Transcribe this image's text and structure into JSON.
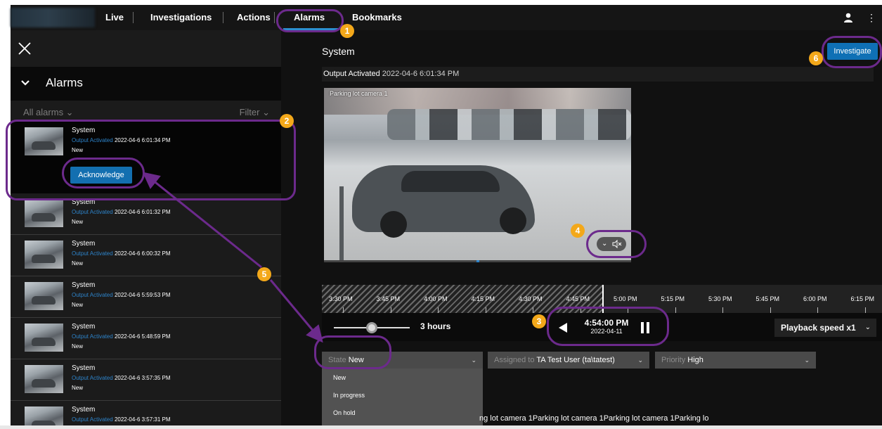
{
  "nav": {
    "items": [
      "Live",
      "Investigations",
      "Actions",
      "Alarms",
      "Bookmarks"
    ],
    "active": "Alarms",
    "user_icon": "user-icon",
    "menu_icon": "kebab-menu-icon"
  },
  "left_panel": {
    "close_icon": "close-icon",
    "header_title": "Alarms",
    "filter_all": "All alarms ⌄",
    "filter_label": "Filter ⌄",
    "alarms": [
      {
        "title": "System",
        "source": "Output Activated",
        "time": "2022-04-6 6:01:34 PM",
        "state": "New",
        "selected": true,
        "action": "Acknowledge"
      },
      {
        "title": "System",
        "source": "Output Activated",
        "time": "2022-04-6 6:01:32 PM",
        "state": "New"
      },
      {
        "title": "System",
        "source": "Output Activated",
        "time": "2022-04-6 6:00:32 PM",
        "state": "New"
      },
      {
        "title": "System",
        "source": "Output Activated",
        "time": "2022-04-6 5:59:53 PM",
        "state": "New"
      },
      {
        "title": "System",
        "source": "Output Activated",
        "time": "2022-04-6 5:48:59 PM",
        "state": "New"
      },
      {
        "title": "System",
        "source": "Output Activated",
        "time": "2022-04-6 3:57:35 PM",
        "state": "New"
      },
      {
        "title": "System",
        "source": "Output Activated",
        "time": "2022-04-6 3:57:31 PM",
        "state": ""
      }
    ]
  },
  "detail": {
    "title": "System",
    "investigate_label": "Investigate",
    "info_event": "Output Activated",
    "info_time": "2022-04-6 6:01:34 PM",
    "camera_name": "Parking lot camera 1",
    "timeline_ticks": [
      "3:30 PM",
      "3:45 PM",
      "4:00 PM",
      "4:15 PM",
      "4:30 PM",
      "4:45 PM",
      "5:00 PM",
      "5:15 PM",
      "5:30 PM",
      "5:45 PM",
      "6:00 PM",
      "6:15 PM"
    ],
    "span_label": "3 hours",
    "current_time": "4:54:00 PM",
    "current_date": "2022-04-11",
    "speed_label": "Playback speed x1",
    "state_label": "State",
    "state_value": "New",
    "assigned_label": "Assigned to",
    "assigned_value": "TA Test User (ta\\tatest)",
    "priority_label": "Priority",
    "priority_value": "High",
    "state_options": [
      "New",
      "In progress",
      "On hold"
    ],
    "description": "ng lot camera 1Parking lot camera 1Parking lot camera 1Parking lo"
  },
  "annotations": [
    "1",
    "2",
    "3",
    "4",
    "5",
    "6"
  ],
  "colors": {
    "accent": "#136fb0",
    "annotation_ring": "#6c2a8c",
    "badge": "#f3a81a"
  }
}
